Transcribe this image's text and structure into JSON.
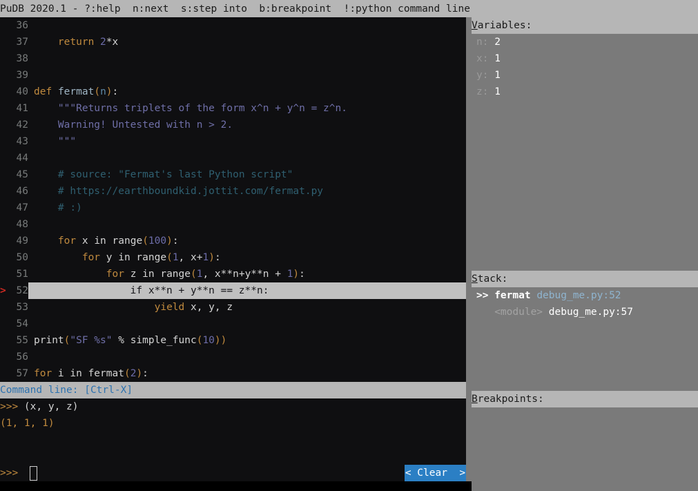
{
  "menubar": {
    "text": "PuDB 2020.1 - ?:help  n:next  s:step into  b:breakpoint  !:python command line"
  },
  "code": {
    "lines": [
      {
        "num": "36",
        "marker": "",
        "current": false,
        "tokens": []
      },
      {
        "num": "37",
        "marker": "",
        "current": false,
        "tokens": [
          {
            "t": "plain",
            "s": "    "
          },
          {
            "t": "kw",
            "s": "return"
          },
          {
            "t": "plain",
            "s": " "
          },
          {
            "t": "num",
            "s": "2"
          },
          {
            "t": "op",
            "s": "*x"
          }
        ]
      },
      {
        "num": "38",
        "marker": "",
        "current": false,
        "tokens": []
      },
      {
        "num": "39",
        "marker": "",
        "current": false,
        "tokens": []
      },
      {
        "num": "40",
        "marker": "",
        "current": false,
        "tokens": [
          {
            "t": "kw",
            "s": "def"
          },
          {
            "t": "plain",
            "s": " "
          },
          {
            "t": "fname",
            "s": "fermat"
          },
          {
            "t": "punct",
            "s": "("
          },
          {
            "t": "arg",
            "s": "n"
          },
          {
            "t": "punct",
            "s": ")"
          },
          {
            "t": "plain",
            "s": ":"
          }
        ]
      },
      {
        "num": "41",
        "marker": "",
        "current": false,
        "tokens": [
          {
            "t": "plain",
            "s": "    "
          },
          {
            "t": "doc",
            "s": "\"\"\"Returns triplets of the form x^n + y^n = z^n."
          }
        ]
      },
      {
        "num": "42",
        "marker": "",
        "current": false,
        "tokens": [
          {
            "t": "plain",
            "s": "    "
          },
          {
            "t": "doc",
            "s": "Warning! Untested with n > 2."
          }
        ]
      },
      {
        "num": "43",
        "marker": "",
        "current": false,
        "tokens": [
          {
            "t": "plain",
            "s": "    "
          },
          {
            "t": "doc",
            "s": "\"\"\""
          }
        ]
      },
      {
        "num": "44",
        "marker": "",
        "current": false,
        "tokens": []
      },
      {
        "num": "45",
        "marker": "",
        "current": false,
        "tokens": [
          {
            "t": "plain",
            "s": "    "
          },
          {
            "t": "comment",
            "s": "# source: \"Fermat's last Python script\""
          }
        ]
      },
      {
        "num": "46",
        "marker": "",
        "current": false,
        "tokens": [
          {
            "t": "plain",
            "s": "    "
          },
          {
            "t": "comment",
            "s": "# https://earthboundkid.jottit.com/fermat.py"
          }
        ]
      },
      {
        "num": "47",
        "marker": "",
        "current": false,
        "tokens": [
          {
            "t": "plain",
            "s": "    "
          },
          {
            "t": "comment",
            "s": "# :)"
          }
        ]
      },
      {
        "num": "48",
        "marker": "",
        "current": false,
        "tokens": []
      },
      {
        "num": "49",
        "marker": "",
        "current": false,
        "tokens": [
          {
            "t": "plain",
            "s": "    "
          },
          {
            "t": "kw",
            "s": "for"
          },
          {
            "t": "plain",
            "s": " x "
          },
          {
            "t": "plain",
            "s": "in"
          },
          {
            "t": "plain",
            "s": " range"
          },
          {
            "t": "punct",
            "s": "("
          },
          {
            "t": "num",
            "s": "100"
          },
          {
            "t": "punct",
            "s": ")"
          },
          {
            "t": "plain",
            "s": ":"
          }
        ]
      },
      {
        "num": "50",
        "marker": "",
        "current": false,
        "tokens": [
          {
            "t": "plain",
            "s": "        "
          },
          {
            "t": "kw",
            "s": "for"
          },
          {
            "t": "plain",
            "s": " y in range"
          },
          {
            "t": "punct",
            "s": "("
          },
          {
            "t": "num",
            "s": "1"
          },
          {
            "t": "plain",
            "s": ", x+"
          },
          {
            "t": "num",
            "s": "1"
          },
          {
            "t": "punct",
            "s": ")"
          },
          {
            "t": "plain",
            "s": ":"
          }
        ]
      },
      {
        "num": "51",
        "marker": "",
        "current": false,
        "tokens": [
          {
            "t": "plain",
            "s": "            "
          },
          {
            "t": "kw",
            "s": "for"
          },
          {
            "t": "plain",
            "s": " z in range"
          },
          {
            "t": "punct",
            "s": "("
          },
          {
            "t": "num",
            "s": "1"
          },
          {
            "t": "plain",
            "s": ", x**n+y**n + "
          },
          {
            "t": "num",
            "s": "1"
          },
          {
            "t": "punct",
            "s": ")"
          },
          {
            "t": "plain",
            "s": ":"
          }
        ]
      },
      {
        "num": "52",
        "marker": ">",
        "current": true,
        "tokens": [
          {
            "t": "plain",
            "s": "                if x**n + y**n == z**n:"
          }
        ]
      },
      {
        "num": "53",
        "marker": "",
        "current": false,
        "tokens": [
          {
            "t": "plain",
            "s": "                    "
          },
          {
            "t": "kw",
            "s": "yield"
          },
          {
            "t": "plain",
            "s": " x, y, z"
          }
        ]
      },
      {
        "num": "54",
        "marker": "",
        "current": false,
        "tokens": []
      },
      {
        "num": "55",
        "marker": "",
        "current": false,
        "tokens": [
          {
            "t": "plain",
            "s": "print"
          },
          {
            "t": "punct",
            "s": "("
          },
          {
            "t": "str",
            "s": "\"SF %s\""
          },
          {
            "t": "plain",
            "s": " % simple_func"
          },
          {
            "t": "punct",
            "s": "("
          },
          {
            "t": "num",
            "s": "10"
          },
          {
            "t": "punct",
            "s": "))"
          }
        ]
      },
      {
        "num": "56",
        "marker": "",
        "current": false,
        "tokens": []
      },
      {
        "num": "57",
        "marker": "",
        "current": false,
        "tokens": [
          {
            "t": "kw",
            "s": "for"
          },
          {
            "t": "plain",
            "s": " i in fermat"
          },
          {
            "t": "punct",
            "s": "("
          },
          {
            "t": "num",
            "s": "2"
          },
          {
            "t": "punct",
            "s": ")"
          },
          {
            "t": "plain",
            "s": ":"
          }
        ]
      }
    ]
  },
  "command_line": {
    "header": "Command line: [Ctrl-X]",
    "history": [
      {
        "prompt": ">>> ",
        "echo": "(x, y, z)",
        "kind": "input"
      },
      {
        "prompt": "",
        "echo": "(1, 1, 1)",
        "kind": "output"
      }
    ],
    "input_prompt": ">>> ",
    "input_value": "",
    "clear_button": "< Clear  >"
  },
  "variables": {
    "title_initial": "V",
    "title_rest": "ariables:",
    "items": [
      {
        "name": "n:",
        "value": "2"
      },
      {
        "name": "x:",
        "value": "1"
      },
      {
        "name": "y:",
        "value": "1"
      },
      {
        "name": "z:",
        "value": "1"
      }
    ]
  },
  "stack": {
    "title_initial": "S",
    "title_rest": "tack:",
    "frames": [
      {
        "marker": ">>",
        "func": "fermat",
        "location": "debug_me.py:52",
        "current": true
      },
      {
        "marker": "",
        "func": "<module>",
        "location": "debug_me.py:57",
        "current": false
      }
    ]
  },
  "breakpoints": {
    "title_initial": "B",
    "title_rest": "reakpoints:",
    "items": []
  },
  "colors": {
    "menubar_bg": "#b6b6b6",
    "panel_bg": "#7a7a7a",
    "code_bg": "#0f0f11",
    "current_line_bg": "#c0c0c0",
    "marker_red": "#cc2a22",
    "accent_blue": "#2b7fc4",
    "cmd_header_text": "#2c72b0"
  }
}
